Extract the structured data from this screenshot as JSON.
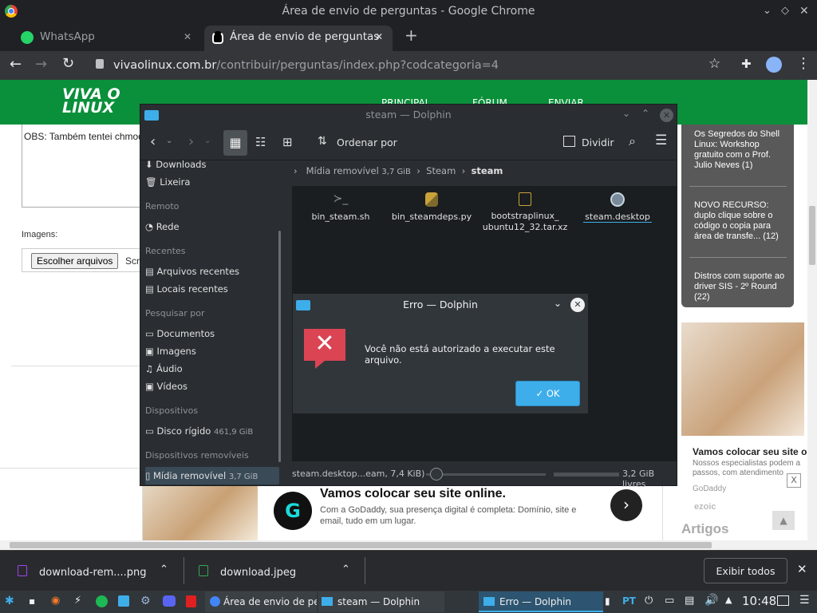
{
  "chrome": {
    "window_title": "Área de envio de perguntas - Google Chrome",
    "tabs": [
      {
        "label": "WhatsApp"
      },
      {
        "label": "Área de envio de perguntas"
      }
    ],
    "url_host": "vivaolinux.com.br",
    "url_path": "/contribuir/perguntas/index.php?codcategoria=4"
  },
  "site": {
    "logo_line1": "VIVA O",
    "logo_line2": "LINUX",
    "nav": [
      "PRINCIPAL",
      "FÓRUM",
      "ENVIAR"
    ],
    "obs_text": "OBS: Também tentei chmod",
    "images_label": "Imagens:",
    "file_button": "Escolher arquivos",
    "file_status": "Scr",
    "sidebar_items": [
      "Os Segredos do Shell Linux: Workshop gratuito com o Prof. Julio Neves (1)",
      "NOVO RECURSO: duplo clique sobre o código o copia para área de transfe... (12)",
      "Distros com suporte ao driver SIS - 2º Round (22)"
    ],
    "ad_headline": "Vamos colocar seu site online.",
    "ad_body": "Com a GoDaddy, sua presença digital é completa: Domínio, site e email, tudo em um lugar.",
    "side_ad_title": "Vamos colocar seu site o",
    "side_ad_body": "Nossos especialistas podem a passos, com atendimento",
    "side_ad_brand": "GoDaddy",
    "ezoic": "ezoic",
    "artigos": "Artigos",
    "close_x": "X"
  },
  "dolphin": {
    "title": "steam — Dolphin",
    "sort_label": "Ordenar por",
    "split_label": "Dividir",
    "breadcrumb": [
      "Mídia removível",
      "3,7 GiB",
      "Steam",
      "steam"
    ],
    "sidebar": {
      "top_items": [
        "Downloads",
        "Lixeira"
      ],
      "sections": [
        {
          "head": "Remoto",
          "items": [
            "Rede"
          ]
        },
        {
          "head": "Recentes",
          "items": [
            "Arquivos recentes",
            "Locais recentes"
          ]
        },
        {
          "head": "Pesquisar por",
          "items": [
            "Documentos",
            "Imagens",
            "Áudio",
            "Vídeos"
          ]
        },
        {
          "head": "Dispositivos",
          "items": [
            "Disco rígido"
          ]
        },
        {
          "head": "Dispositivos removíveis",
          "items": [
            "Mídia removível"
          ]
        }
      ],
      "disk_size": "461,9 GiB",
      "removable_size": "3,7 GiB"
    },
    "files": [
      {
        "name": "bin_steam.sh",
        "icon": "script-icon"
      },
      {
        "name": "bin_steamdeps.py",
        "icon": "python-icon"
      },
      {
        "name": "bootstraplinux_",
        "name2": "ubuntu12_32.tar.xz",
        "icon": "archive-icon"
      },
      {
        "name": "steam.desktop",
        "icon": "steam-icon"
      }
    ],
    "status_left": "steam.desktop...eam, 7,4 KiB)",
    "free_space": "3,2 GiB livres"
  },
  "dialog": {
    "title": "Erro — Dolphin",
    "message": "Você não está autorizado a executar este arquivo.",
    "ok_label": "OK"
  },
  "downloads": {
    "items": [
      "download-rem....png",
      "download.jpeg"
    ],
    "show_all": "Exibir todos"
  },
  "taskbar": {
    "tasks": [
      "Área de envio de perg",
      "steam — Dolphin",
      "Erro — Dolphin"
    ],
    "lang": "PT",
    "clock": "10:48"
  }
}
